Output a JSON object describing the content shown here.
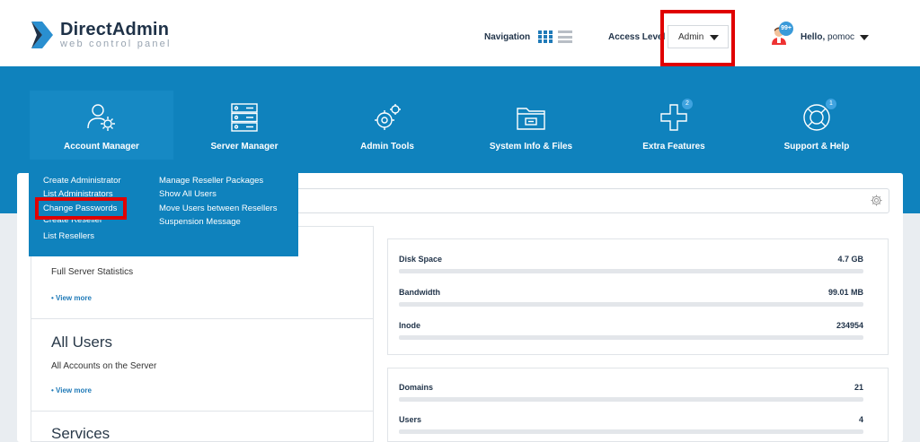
{
  "logo": {
    "title": "DirectAdmin",
    "subtitle": "web control panel"
  },
  "header": {
    "navigation_label": "Navigation",
    "access_level_label": "Access Level",
    "access_level_value": "Admin",
    "user_badge": "99+",
    "hello_prefix": "Hello,",
    "username": "pomoc"
  },
  "nav": {
    "items": [
      {
        "label": "Account Manager",
        "icon": "users-gear-icon"
      },
      {
        "label": "Server Manager",
        "icon": "server-icon"
      },
      {
        "label": "Admin Tools",
        "icon": "tools-gear-icon"
      },
      {
        "label": "System Info & Files",
        "icon": "folder-icon"
      },
      {
        "label": "Extra Features",
        "icon": "plus-icon",
        "badge": "2"
      },
      {
        "label": "Support & Help",
        "icon": "lifebuoy-icon",
        "badge": "1"
      }
    ]
  },
  "dropdown": {
    "col1": [
      "Create Administrator",
      "List Administrators",
      "Change Passwords",
      "Create Reseller",
      "List Resellers"
    ],
    "col2": [
      "Manage Reseller Packages",
      "Show All Users",
      "Move Users between Resellers",
      "Suspension Message"
    ]
  },
  "sections": [
    {
      "title": "",
      "subtitle": "Full Server Statistics",
      "link": "• View more"
    },
    {
      "title": "All Users",
      "subtitle": "All Accounts on the Server",
      "link": "• View more"
    },
    {
      "title": "Services",
      "subtitle": "",
      "link": ""
    }
  ],
  "stats_box1": [
    {
      "label": "Disk Space",
      "value": "4.7 GB"
    },
    {
      "label": "Bandwidth",
      "value": "99.01 MB"
    },
    {
      "label": "Inode",
      "value": "234954"
    }
  ],
  "stats_box2": [
    {
      "label": "Domains",
      "value": "21"
    },
    {
      "label": "Users",
      "value": "4"
    }
  ],
  "colors": {
    "brand_blue": "#0f82bd",
    "highlight_red": "#e00000",
    "link_blue": "#1f7ab8"
  }
}
